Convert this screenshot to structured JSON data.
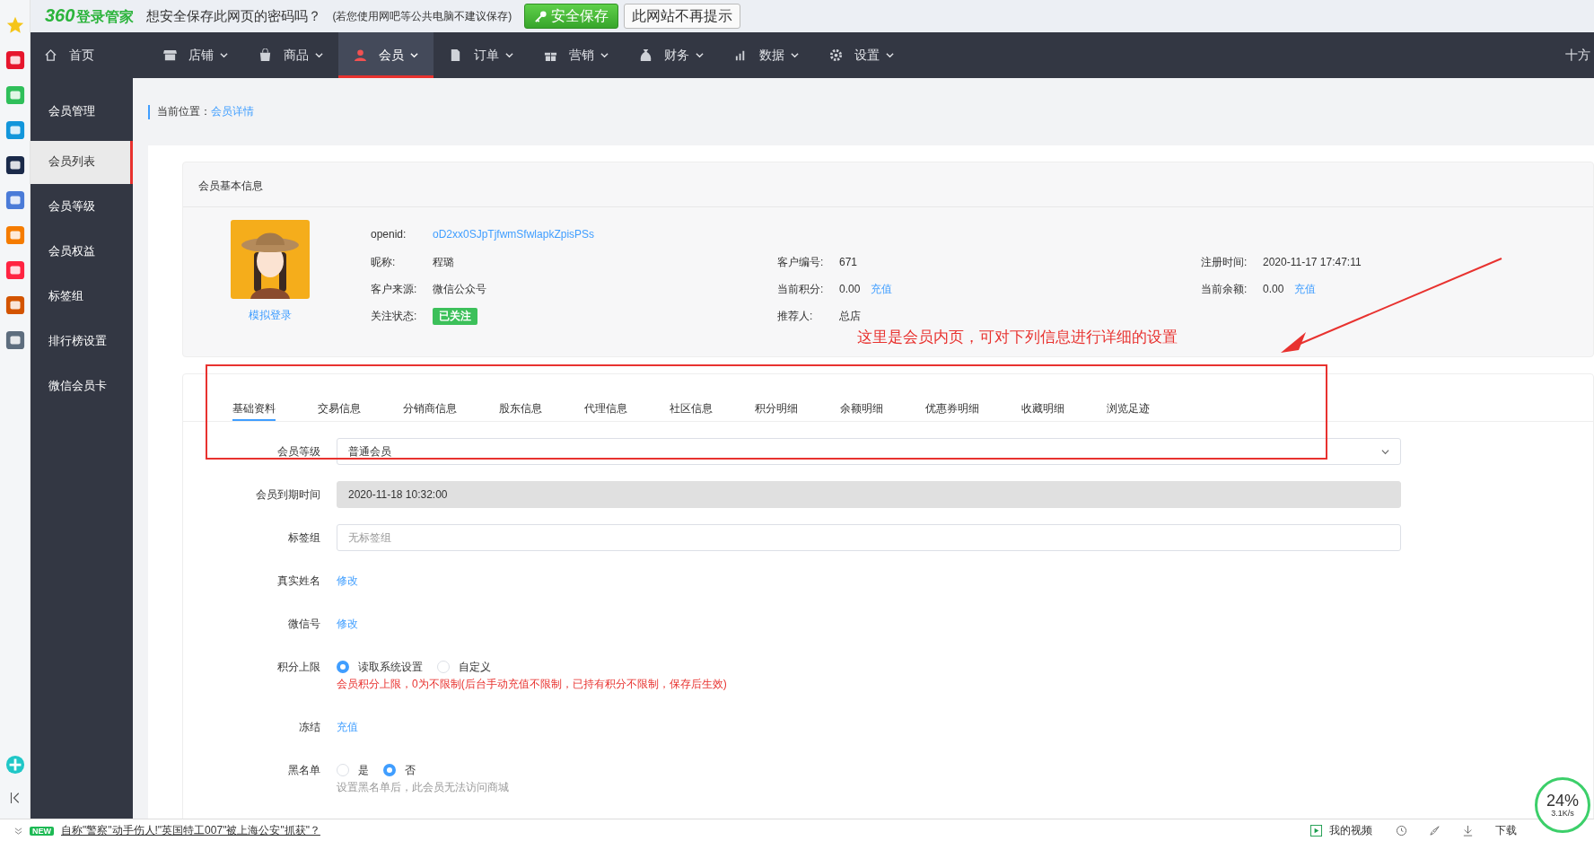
{
  "password_bar": {
    "brand_number": "360",
    "brand_name": "登录管家",
    "question": "想安全保存此网页的密码吗？",
    "note": "(若您使用网吧等公共电脑不建议保存)",
    "save_button": "安全保存",
    "dismiss_button": "此网站不再提示"
  },
  "nav": {
    "items": [
      {
        "label": "首页",
        "dropdown": false,
        "selected": false
      },
      {
        "label": "店铺",
        "dropdown": true,
        "selected": false
      },
      {
        "label": "商品",
        "dropdown": true,
        "selected": false
      },
      {
        "label": "会员",
        "dropdown": true,
        "selected": true
      },
      {
        "label": "订单",
        "dropdown": true,
        "selected": false
      },
      {
        "label": "营销",
        "dropdown": true,
        "selected": false
      },
      {
        "label": "财务",
        "dropdown": true,
        "selected": false
      },
      {
        "label": "数据",
        "dropdown": true,
        "selected": false
      },
      {
        "label": "设置",
        "dropdown": true,
        "selected": false
      }
    ],
    "right_text": "十方"
  },
  "sidebar": {
    "title": "会员管理",
    "items": [
      {
        "label": "会员列表",
        "selected": true
      },
      {
        "label": "会员等级",
        "selected": false
      },
      {
        "label": "会员权益",
        "selected": false
      },
      {
        "label": "标签组",
        "selected": false
      },
      {
        "label": "排行榜设置",
        "selected": false
      },
      {
        "label": "微信会员卡",
        "selected": false
      }
    ]
  },
  "breadcrumb": {
    "label": "当前位置：",
    "current": "会员详情"
  },
  "member_card": {
    "title": "会员基本信息",
    "avatar_link": "模拟登录",
    "rows": [
      {
        "cells": [
          {
            "label": "openid:",
            "value": "oD2xx0SJpTjfwmSfwlapkZpisPSs",
            "kind": "link"
          }
        ]
      },
      {
        "cells": [
          {
            "label": "昵称:",
            "value": "程璐",
            "kind": "text"
          },
          {
            "label": "客户编号:",
            "value": "671",
            "kind": "text"
          },
          {
            "label": "注册时间:",
            "value": "2020-11-17 17:47:11",
            "kind": "text"
          }
        ]
      },
      {
        "cells": [
          {
            "label": "客户来源:",
            "value": "微信公众号",
            "kind": "text"
          },
          {
            "label": "当前积分:",
            "value": "0.00",
            "kind": "text",
            "action": "充值"
          },
          {
            "label": "当前余额:",
            "value": "0.00",
            "kind": "text",
            "action": "充值"
          }
        ]
      },
      {
        "cells": [
          {
            "label": "关注状态:",
            "value": "已关注",
            "kind": "badge"
          },
          {
            "label": "推荐人:",
            "value": "总店",
            "kind": "text"
          }
        ]
      }
    ]
  },
  "annotation": {
    "text": "这里是会员内页，可对下列信息进行详细的设置"
  },
  "tabs": [
    {
      "label": "基础资料",
      "selected": true
    },
    {
      "label": "交易信息",
      "selected": false
    },
    {
      "label": "分销商信息",
      "selected": false
    },
    {
      "label": "股东信息",
      "selected": false
    },
    {
      "label": "代理信息",
      "selected": false
    },
    {
      "label": "社区信息",
      "selected": false
    },
    {
      "label": "积分明细",
      "selected": false
    },
    {
      "label": "余额明细",
      "selected": false
    },
    {
      "label": "优惠券明细",
      "selected": false
    },
    {
      "label": "收藏明细",
      "selected": false
    },
    {
      "label": "浏览足迹",
      "selected": false
    }
  ],
  "form": [
    {
      "kind": "select",
      "label": "会员等级",
      "value": "普通会员"
    },
    {
      "kind": "readonly",
      "label": "会员到期时间",
      "value": "2020-11-18 10:32:00"
    },
    {
      "kind": "input",
      "label": "标签组",
      "placeholder": "无标签组"
    },
    {
      "kind": "link",
      "label": "真实姓名",
      "value": "修改"
    },
    {
      "kind": "link",
      "label": "微信号",
      "value": "修改"
    },
    {
      "kind": "radio",
      "label": "积分上限",
      "options": [
        {
          "label": "读取系统设置",
          "selected": true
        },
        {
          "label": "自定义",
          "selected": false
        }
      ],
      "hint": "会员积分上限，0为不限制(后台手动充值不限制，已持有积分不限制，保存后生效)",
      "warning": true
    },
    {
      "kind": "link",
      "label": "冻结",
      "value": "充值"
    },
    {
      "kind": "radio",
      "label": "黑名单",
      "options": [
        {
          "label": "是",
          "selected": false
        },
        {
          "label": "否",
          "selected": true
        }
      ],
      "hint": "设置黑名单后，此会员无法访问商城",
      "warning": false
    }
  ],
  "status_bar": {
    "badge": "NEW",
    "headline": "自称\"警察\"动手伤人!\"英国特工007\"被上海公安\"抓获\"？",
    "video": "我的视频",
    "download": "下载",
    "speed_percent": "24%",
    "speed_rate": "3.1K/s"
  }
}
